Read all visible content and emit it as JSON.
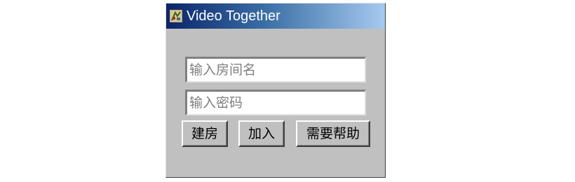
{
  "window": {
    "title": "Video Together",
    "icon": "app-icon"
  },
  "form": {
    "room_placeholder": "输入房间名",
    "password_placeholder": "输入密码",
    "room_value": "",
    "password_value": ""
  },
  "buttons": {
    "create_label": "建房",
    "join_label": "加入",
    "help_label": "需要帮助"
  },
  "colors": {
    "window_bg": "#c0c0c0",
    "titlebar_start": "#0a246a",
    "titlebar_end": "#a6caf0",
    "title_text": "#ffffff"
  }
}
